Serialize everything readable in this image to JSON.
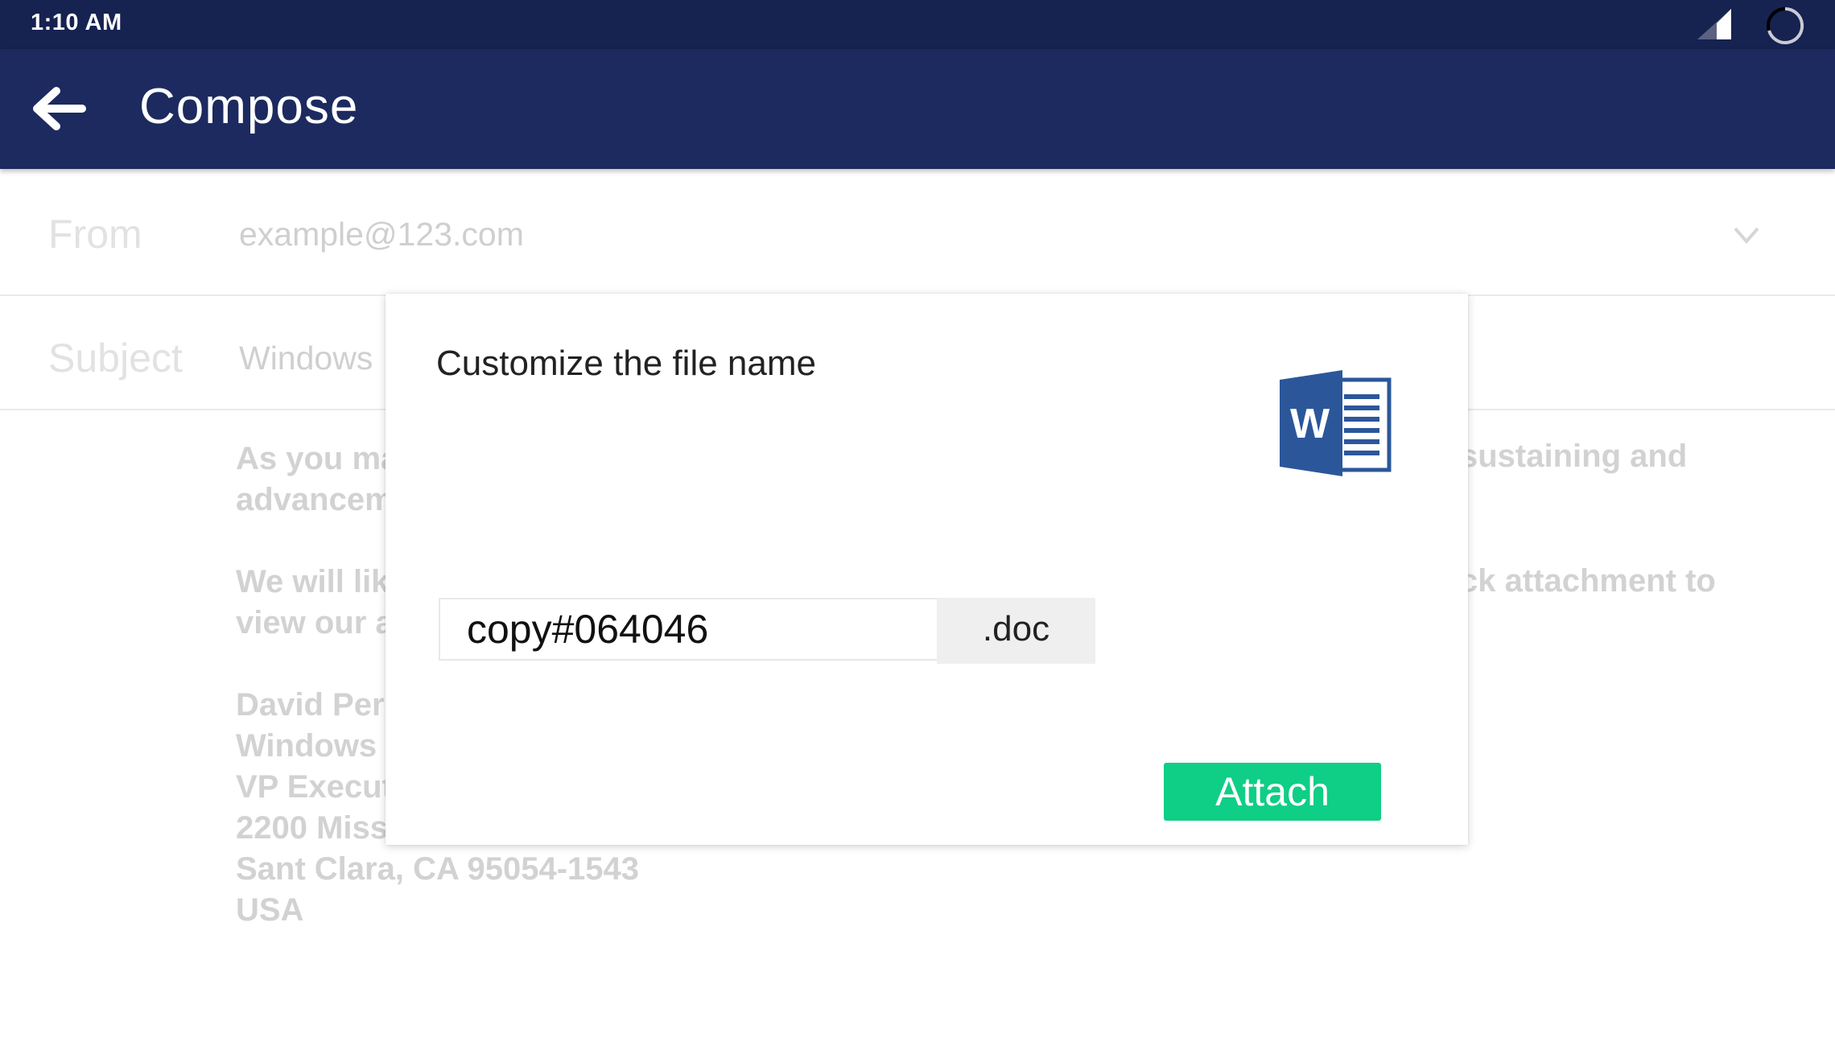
{
  "status_bar": {
    "time": "1:10 AM",
    "icons": [
      "signal-icon",
      "battery-icon"
    ]
  },
  "app_bar": {
    "back_icon": "arrow-left-icon",
    "title": "Compose",
    "background_color": "#1c2a5f"
  },
  "compose": {
    "from": {
      "label": "From",
      "value": "example@123.com",
      "dropdown_icon": "chevron-down-icon"
    },
    "subject": {
      "label": "Subject",
      "value": "Windows"
    },
    "body": {
      "paragraph_1": [
        "As you ma",
        "advancem"
      ],
      "paragraph_1_tail": "sustaining and",
      "paragraph_2": [
        "We will lik",
        "view our a"
      ],
      "paragraph_2_tail": "ck attachment to",
      "signature": [
        "David Perl",
        "Windows",
        "VP Execut",
        "2200 Miss",
        "Sant Clara, CA 95054-1543",
        "USA"
      ]
    }
  },
  "dialog": {
    "title": "Customize the file name",
    "file_icon": "word-document-icon",
    "file_name": "copy#064046",
    "extension": ".doc",
    "attach_label": "Attach",
    "attach_color": "#0fce85"
  }
}
